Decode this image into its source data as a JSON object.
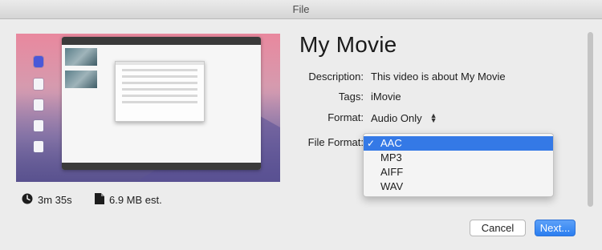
{
  "window": {
    "title": "File"
  },
  "movie": {
    "title": "My Movie"
  },
  "fields": {
    "description": {
      "label": "Description:",
      "value": "This video is about My Movie"
    },
    "tags": {
      "label": "Tags:",
      "value": "iMovie"
    },
    "format": {
      "label": "Format:",
      "value": "Audio Only"
    },
    "file_format": {
      "label": "File Format:"
    }
  },
  "file_format_menu": {
    "options": [
      "AAC",
      "MP3",
      "AIFF",
      "WAV"
    ],
    "selected": "AAC"
  },
  "meta": {
    "duration": "3m 35s",
    "size": "6.9 MB est."
  },
  "buttons": {
    "cancel": "Cancel",
    "next": "Next..."
  },
  "colors": {
    "accent": "#3479e6",
    "primary_button": "#2a7ef0"
  },
  "icons": {
    "duration": "clock-icon",
    "size": "document-icon",
    "format_stepper": "up-down-arrows-icon",
    "selected_check": "checkmark-icon"
  }
}
